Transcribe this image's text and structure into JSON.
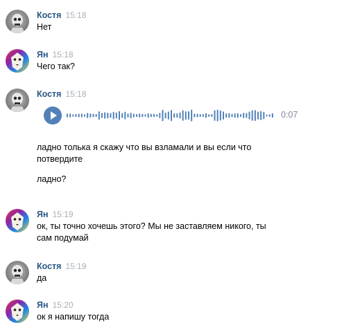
{
  "messages": [
    {
      "author": "Костя",
      "time": "15:18",
      "avatar": "skeleton-avatar",
      "lines": [
        "Нет"
      ]
    },
    {
      "author": "Ян",
      "time": "15:18",
      "avatar": "lion-avatar",
      "lines": [
        "Чего так?"
      ]
    },
    {
      "author": "Костя",
      "time": "15:18",
      "avatar": "skeleton-avatar",
      "voice": {
        "duration": "0:07",
        "icon": "play-icon"
      },
      "lines": [
        "ладно толька я скажу что вы взламали и вы если что потвердите",
        "ладно?"
      ]
    },
    {
      "author": "Ян",
      "time": "15:19",
      "avatar": "lion-avatar",
      "lines": [
        "ок, ты точно хочешь этого? Мы не заставляем никого, ты сам подумай"
      ]
    },
    {
      "author": "Костя",
      "time": "15:19",
      "avatar": "skeleton-avatar",
      "lines": [
        "да"
      ]
    },
    {
      "author": "Ян",
      "time": "15:20",
      "avatar": "lion-avatar",
      "lines": [
        "ок я напишу тогда"
      ]
    }
  ],
  "colors": {
    "author": "#2a5885",
    "time": "#a6afb9",
    "play_button": "#5181b8",
    "waveform": "#5181b8"
  }
}
